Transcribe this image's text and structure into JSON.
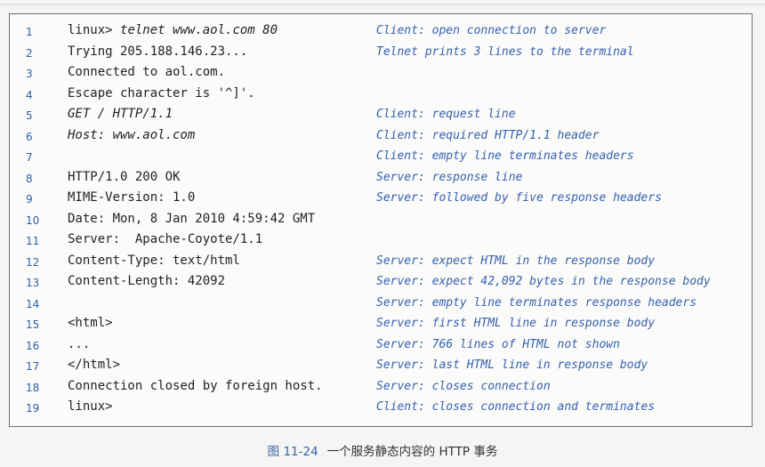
{
  "listing": {
    "lines": [
      {
        "num": "1",
        "code": "linux> ",
        "input": "telnet www.aol.com 80",
        "comment": "Client: open connection to server"
      },
      {
        "num": "2",
        "code": "Trying 205.188.146.23...",
        "input": "",
        "comment": "Telnet prints 3 lines to the terminal"
      },
      {
        "num": "3",
        "code": "Connected to aol.com.",
        "input": "",
        "comment": ""
      },
      {
        "num": "4",
        "code": "Escape character is '^]'.",
        "input": "",
        "comment": ""
      },
      {
        "num": "5",
        "code": "",
        "input": "GET / HTTP/1.1",
        "comment": "Client: request line"
      },
      {
        "num": "6",
        "code": "",
        "input": "Host: www.aol.com",
        "comment": "Client: required HTTP/1.1 header"
      },
      {
        "num": "7",
        "code": "",
        "input": "",
        "comment": "Client: empty line terminates headers"
      },
      {
        "num": "8",
        "code": "HTTP/1.0 200 OK",
        "input": "",
        "comment": "Server: response line"
      },
      {
        "num": "9",
        "code": "MIME-Version: 1.0",
        "input": "",
        "comment": "Server: followed by five response headers"
      },
      {
        "num": "10",
        "code": "Date: Mon, 8 Jan 2010 4:59:42 GMT",
        "input": "",
        "comment": ""
      },
      {
        "num": "11",
        "code": "Server:  Apache-Coyote/1.1",
        "input": "",
        "comment": ""
      },
      {
        "num": "12",
        "code": "Content-Type: text/html",
        "input": "",
        "comment": "Server: expect HTML in the response body"
      },
      {
        "num": "13",
        "code": "Content-Length: 42092",
        "input": "",
        "comment": "Server: expect 42,092 bytes in the response body"
      },
      {
        "num": "14",
        "code": "",
        "input": "",
        "comment": "Server: empty line terminates response headers"
      },
      {
        "num": "15",
        "code": "<html>",
        "input": "",
        "comment": "Server: first HTML line in response body"
      },
      {
        "num": "16",
        "code": "...",
        "input": "",
        "comment": "Server: 766 lines of HTML not shown"
      },
      {
        "num": "17",
        "code": "</html>",
        "input": "",
        "comment": "Server: last HTML line in response body"
      },
      {
        "num": "18",
        "code": "Connection closed by foreign host.",
        "input": "",
        "comment": "Server: closes connection"
      },
      {
        "num": "19",
        "code": "linux>",
        "input": "",
        "comment": "Client: closes connection and terminates"
      }
    ]
  },
  "caption": {
    "figure": "图 11-24",
    "text": "一个服务静态内容的 HTTP 事务"
  }
}
